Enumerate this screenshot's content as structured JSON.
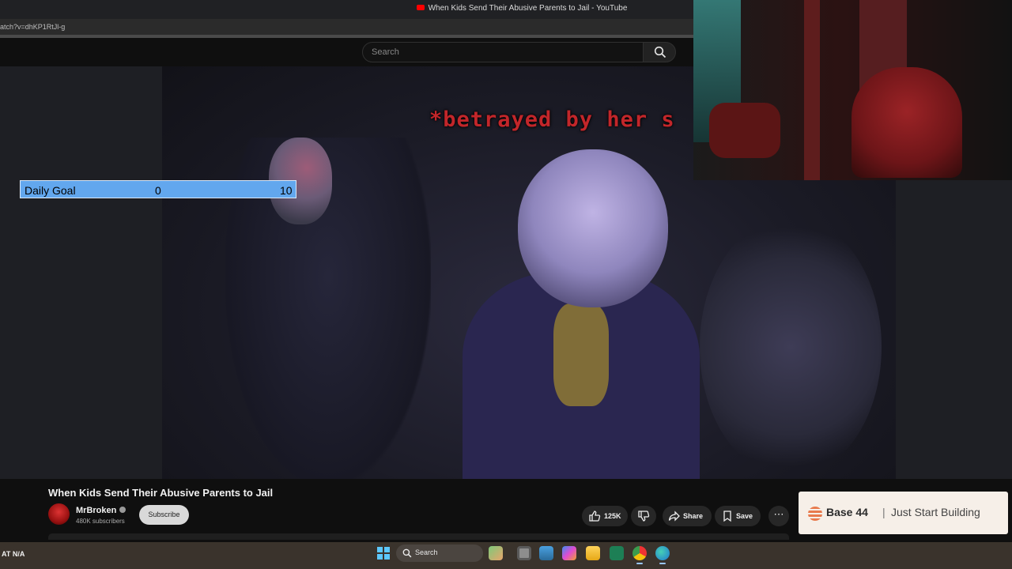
{
  "browser": {
    "tab_title": "When Kids Send Their Abusive Parents to Jail - YouTube",
    "url": "atch?v=dhKP1RtJl-g"
  },
  "youtube": {
    "search_placeholder": "Search"
  },
  "video": {
    "caption_text": "*betrayed by her s",
    "title": "When Kids Send Their Abusive Parents to Jail",
    "channel": "MrBroken",
    "subscribers": "480K subscribers",
    "subscribe_label": "Subscribe",
    "likes": "125K",
    "share_label": "Share",
    "save_label": "Save"
  },
  "overlay": {
    "goal_label": "Daily Goal",
    "goal_current": "0",
    "goal_target": "10"
  },
  "ad": {
    "brand": "Base 44",
    "separator": "|",
    "tagline": "Just Start Building"
  },
  "taskbar": {
    "weather": "AT  N/A",
    "search_placeholder": "Search",
    "apps": [
      "copilot-icon",
      "task-view-icon",
      "widgets-icon",
      "copilot-app-icon",
      "file-explorer-icon",
      "store-icon",
      "chrome-icon",
      "edge-icon"
    ]
  },
  "colors": {
    "goal_bar": "#62a7ee",
    "caption": "#c2262a",
    "ad_background": "#f6efe8",
    "ad_logo": "#e87a4d"
  }
}
